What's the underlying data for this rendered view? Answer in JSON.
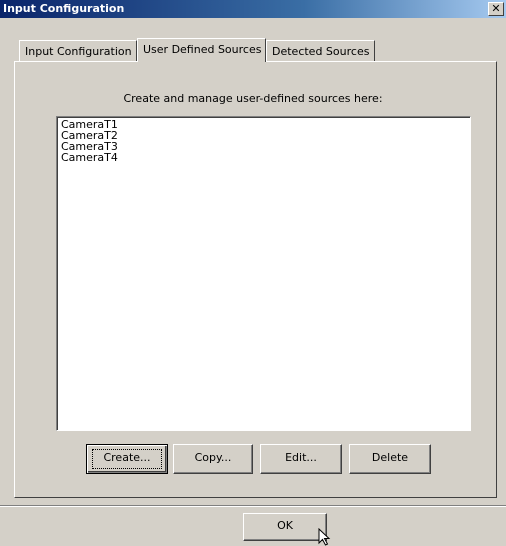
{
  "window": {
    "title": "Input Configuration",
    "close_glyph": "✕"
  },
  "tabs": [
    {
      "label": "Input Configuration"
    },
    {
      "label": "User Defined Sources",
      "active": true
    },
    {
      "label": "Detected Sources"
    }
  ],
  "panel": {
    "instruction": "Create and manage user-defined sources here:",
    "sources": [
      "CameraT1",
      "CameraT2",
      "CameraT3",
      "CameraT4"
    ]
  },
  "buttons": {
    "create": "Create...",
    "copy": "Copy...",
    "edit": "Edit...",
    "delete": "Delete"
  },
  "footer": {
    "ok": "OK"
  }
}
